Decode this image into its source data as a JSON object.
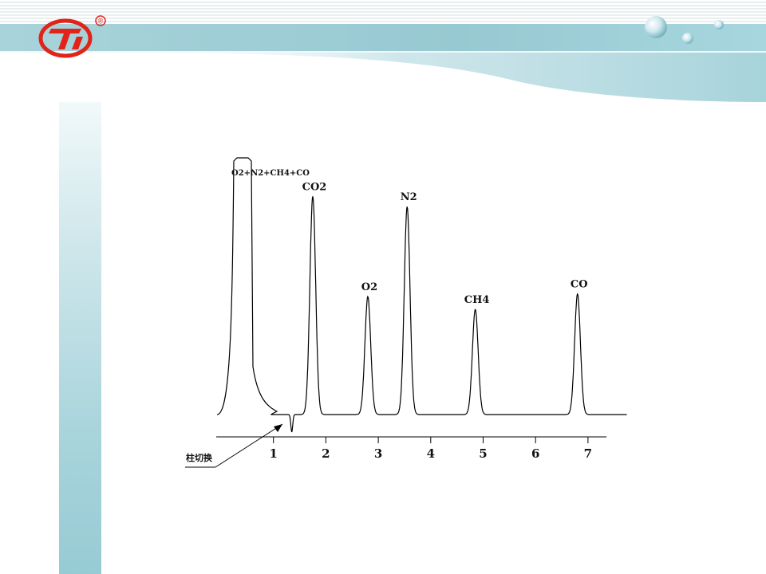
{
  "chart_data": {
    "type": "line",
    "x_ticks": [
      "1",
      "2",
      "3",
      "4",
      "5",
      "6",
      "7"
    ],
    "xlim": [
      0.0,
      7.5
    ],
    "peaks": [
      {
        "label": "O2+N2+CH4+CO",
        "x": 0.0,
        "rel_height": 1.0,
        "flat_top": true
      },
      {
        "label": "CO2",
        "x": 1.75,
        "rel_height": 0.85
      },
      {
        "label": "O2",
        "x": 2.8,
        "rel_height": 0.46
      },
      {
        "label": "N2",
        "x": 3.55,
        "rel_height": 0.81
      },
      {
        "label": "CH4",
        "x": 4.85,
        "rel_height": 0.41
      },
      {
        "label": "CO",
        "x": 6.8,
        "rel_height": 0.47
      }
    ],
    "annotation": "柱切换",
    "grid": false,
    "legend": "none"
  },
  "icons": {
    "logo": "brand-logo-icon",
    "registered": "®",
    "decor": "water-bubbles"
  },
  "colors": {
    "logo_red": "#e2231a",
    "band": "#9ccdd5",
    "line": "#000000"
  }
}
